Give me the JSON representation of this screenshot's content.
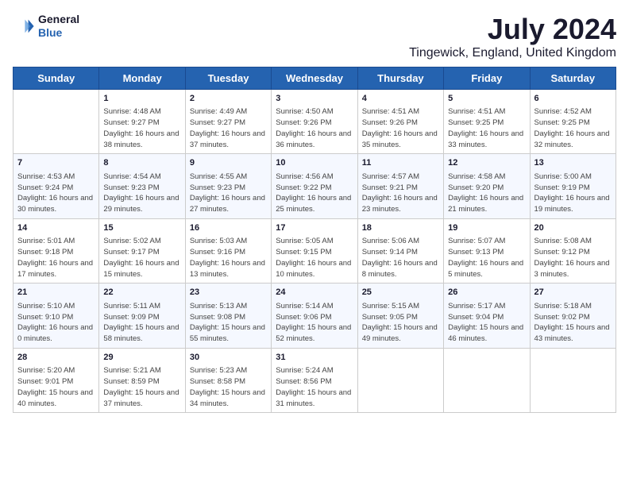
{
  "header": {
    "logo": {
      "general": "General",
      "blue": "Blue"
    },
    "title": "July 2024",
    "location": "Tingewick, England, United Kingdom"
  },
  "calendar": {
    "weekdays": [
      "Sunday",
      "Monday",
      "Tuesday",
      "Wednesday",
      "Thursday",
      "Friday",
      "Saturday"
    ],
    "weeks": [
      [
        {
          "day": "",
          "sunrise": "",
          "sunset": "",
          "daylight": ""
        },
        {
          "day": "1",
          "sunrise": "Sunrise: 4:48 AM",
          "sunset": "Sunset: 9:27 PM",
          "daylight": "Daylight: 16 hours and 38 minutes."
        },
        {
          "day": "2",
          "sunrise": "Sunrise: 4:49 AM",
          "sunset": "Sunset: 9:27 PM",
          "daylight": "Daylight: 16 hours and 37 minutes."
        },
        {
          "day": "3",
          "sunrise": "Sunrise: 4:50 AM",
          "sunset": "Sunset: 9:26 PM",
          "daylight": "Daylight: 16 hours and 36 minutes."
        },
        {
          "day": "4",
          "sunrise": "Sunrise: 4:51 AM",
          "sunset": "Sunset: 9:26 PM",
          "daylight": "Daylight: 16 hours and 35 minutes."
        },
        {
          "day": "5",
          "sunrise": "Sunrise: 4:51 AM",
          "sunset": "Sunset: 9:25 PM",
          "daylight": "Daylight: 16 hours and 33 minutes."
        },
        {
          "day": "6",
          "sunrise": "Sunrise: 4:52 AM",
          "sunset": "Sunset: 9:25 PM",
          "daylight": "Daylight: 16 hours and 32 minutes."
        }
      ],
      [
        {
          "day": "7",
          "sunrise": "Sunrise: 4:53 AM",
          "sunset": "Sunset: 9:24 PM",
          "daylight": "Daylight: 16 hours and 30 minutes."
        },
        {
          "day": "8",
          "sunrise": "Sunrise: 4:54 AM",
          "sunset": "Sunset: 9:23 PM",
          "daylight": "Daylight: 16 hours and 29 minutes."
        },
        {
          "day": "9",
          "sunrise": "Sunrise: 4:55 AM",
          "sunset": "Sunset: 9:23 PM",
          "daylight": "Daylight: 16 hours and 27 minutes."
        },
        {
          "day": "10",
          "sunrise": "Sunrise: 4:56 AM",
          "sunset": "Sunset: 9:22 PM",
          "daylight": "Daylight: 16 hours and 25 minutes."
        },
        {
          "day": "11",
          "sunrise": "Sunrise: 4:57 AM",
          "sunset": "Sunset: 9:21 PM",
          "daylight": "Daylight: 16 hours and 23 minutes."
        },
        {
          "day": "12",
          "sunrise": "Sunrise: 4:58 AM",
          "sunset": "Sunset: 9:20 PM",
          "daylight": "Daylight: 16 hours and 21 minutes."
        },
        {
          "day": "13",
          "sunrise": "Sunrise: 5:00 AM",
          "sunset": "Sunset: 9:19 PM",
          "daylight": "Daylight: 16 hours and 19 minutes."
        }
      ],
      [
        {
          "day": "14",
          "sunrise": "Sunrise: 5:01 AM",
          "sunset": "Sunset: 9:18 PM",
          "daylight": "Daylight: 16 hours and 17 minutes."
        },
        {
          "day": "15",
          "sunrise": "Sunrise: 5:02 AM",
          "sunset": "Sunset: 9:17 PM",
          "daylight": "Daylight: 16 hours and 15 minutes."
        },
        {
          "day": "16",
          "sunrise": "Sunrise: 5:03 AM",
          "sunset": "Sunset: 9:16 PM",
          "daylight": "Daylight: 16 hours and 13 minutes."
        },
        {
          "day": "17",
          "sunrise": "Sunrise: 5:05 AM",
          "sunset": "Sunset: 9:15 PM",
          "daylight": "Daylight: 16 hours and 10 minutes."
        },
        {
          "day": "18",
          "sunrise": "Sunrise: 5:06 AM",
          "sunset": "Sunset: 9:14 PM",
          "daylight": "Daylight: 16 hours and 8 minutes."
        },
        {
          "day": "19",
          "sunrise": "Sunrise: 5:07 AM",
          "sunset": "Sunset: 9:13 PM",
          "daylight": "Daylight: 16 hours and 5 minutes."
        },
        {
          "day": "20",
          "sunrise": "Sunrise: 5:08 AM",
          "sunset": "Sunset: 9:12 PM",
          "daylight": "Daylight: 16 hours and 3 minutes."
        }
      ],
      [
        {
          "day": "21",
          "sunrise": "Sunrise: 5:10 AM",
          "sunset": "Sunset: 9:10 PM",
          "daylight": "Daylight: 16 hours and 0 minutes."
        },
        {
          "day": "22",
          "sunrise": "Sunrise: 5:11 AM",
          "sunset": "Sunset: 9:09 PM",
          "daylight": "Daylight: 15 hours and 58 minutes."
        },
        {
          "day": "23",
          "sunrise": "Sunrise: 5:13 AM",
          "sunset": "Sunset: 9:08 PM",
          "daylight": "Daylight: 15 hours and 55 minutes."
        },
        {
          "day": "24",
          "sunrise": "Sunrise: 5:14 AM",
          "sunset": "Sunset: 9:06 PM",
          "daylight": "Daylight: 15 hours and 52 minutes."
        },
        {
          "day": "25",
          "sunrise": "Sunrise: 5:15 AM",
          "sunset": "Sunset: 9:05 PM",
          "daylight": "Daylight: 15 hours and 49 minutes."
        },
        {
          "day": "26",
          "sunrise": "Sunrise: 5:17 AM",
          "sunset": "Sunset: 9:04 PM",
          "daylight": "Daylight: 15 hours and 46 minutes."
        },
        {
          "day": "27",
          "sunrise": "Sunrise: 5:18 AM",
          "sunset": "Sunset: 9:02 PM",
          "daylight": "Daylight: 15 hours and 43 minutes."
        }
      ],
      [
        {
          "day": "28",
          "sunrise": "Sunrise: 5:20 AM",
          "sunset": "Sunset: 9:01 PM",
          "daylight": "Daylight: 15 hours and 40 minutes."
        },
        {
          "day": "29",
          "sunrise": "Sunrise: 5:21 AM",
          "sunset": "Sunset: 8:59 PM",
          "daylight": "Daylight: 15 hours and 37 minutes."
        },
        {
          "day": "30",
          "sunrise": "Sunrise: 5:23 AM",
          "sunset": "Sunset: 8:58 PM",
          "daylight": "Daylight: 15 hours and 34 minutes."
        },
        {
          "day": "31",
          "sunrise": "Sunrise: 5:24 AM",
          "sunset": "Sunset: 8:56 PM",
          "daylight": "Daylight: 15 hours and 31 minutes."
        },
        {
          "day": "",
          "sunrise": "",
          "sunset": "",
          "daylight": ""
        },
        {
          "day": "",
          "sunrise": "",
          "sunset": "",
          "daylight": ""
        },
        {
          "day": "",
          "sunrise": "",
          "sunset": "",
          "daylight": ""
        }
      ]
    ]
  }
}
